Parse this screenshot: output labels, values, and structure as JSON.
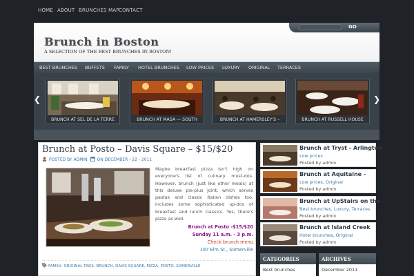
{
  "top_nav": [
    "HOME",
    "ABOUT",
    "BRUNCHES MAP",
    "CONTACT"
  ],
  "search": {
    "button": "GO"
  },
  "site": {
    "title": "Brunch in Boston",
    "tagline": "A SELECTION OF THE BEST BRUNCHES IN BOSTON!"
  },
  "category_nav": [
    "BEST BRUNCHES",
    "BUFFETS",
    "FAMILY",
    "HOTEL BRUNCHES",
    "LOW PRICES",
    "LUXURY",
    "ORIGINAL",
    "TERRACES"
  ],
  "slider": {
    "slides": [
      {
        "caption": "BRUNCH AT SEL DE LA TERRE"
      },
      {
        "caption": "BRUNCH AT MASA — SOUTH"
      },
      {
        "caption": "BRUNCH AT HAMERSLEY'S –"
      },
      {
        "caption": "BRUNCH AT RUSSELL HOUSE"
      }
    ],
    "prev_icon": "chevron-left",
    "next_icon": "chevron-right"
  },
  "post": {
    "title": "Brunch at Posto – Davis Square – $15/$20",
    "meta_posted_by": "POSTED BY",
    "meta_author": "ADMIN",
    "meta_on": "ON",
    "meta_date": "DECEMBER - 22 - 2011",
    "text": "Maybe breakfast pizza isn't high on everyone's list of culinary must-dos. However, brunch (just like other meals) at this deluxe pie-plus joint, which serves pastas and classic Italian dishes too, includes some sophisticated up-dos of breakfast and lunch classics. Yes, there's pizza as well.",
    "info_title": "Brunch at Posto -$15/$20",
    "info_hours": "Sunday 11 a.m. - 3 p.m.",
    "info_link": "Check brunch menu",
    "info_address": "187 Elm St., Somerville",
    "tags_line": "FAMILY, ORIGINAL   TAGS: BRUNCH, DAVIS SQUARE, PIZZA, POSTO, SOMERVILLE"
  },
  "sidebar_posts": [
    {
      "title": "Brunch at Tryst - Arlington",
      "cats": "Low prices",
      "author": "Posted by admin"
    },
    {
      "title": "Brunch at Aquitaine -",
      "cats": "Low prices, Original",
      "author": "Posted by admin"
    },
    {
      "title": "Brunch at UpStairs on the",
      "cats": "Best brunches, Luxury, Terraces",
      "author": "Posted by admin"
    },
    {
      "title": "Brunch at Island Creek",
      "cats": "Hotel brunches, Original",
      "author": "Posted by admin"
    }
  ],
  "widgets": {
    "categories": {
      "heading": "CATEGORIES",
      "first": "Best brunches"
    },
    "archives": {
      "heading": "ARCHIVES",
      "first": "December 2011"
    }
  },
  "colors": {
    "background": "#1f2226",
    "link": "#3a78a8",
    "info_title": "#8b1a8b",
    "info_link": "#c0392b"
  }
}
